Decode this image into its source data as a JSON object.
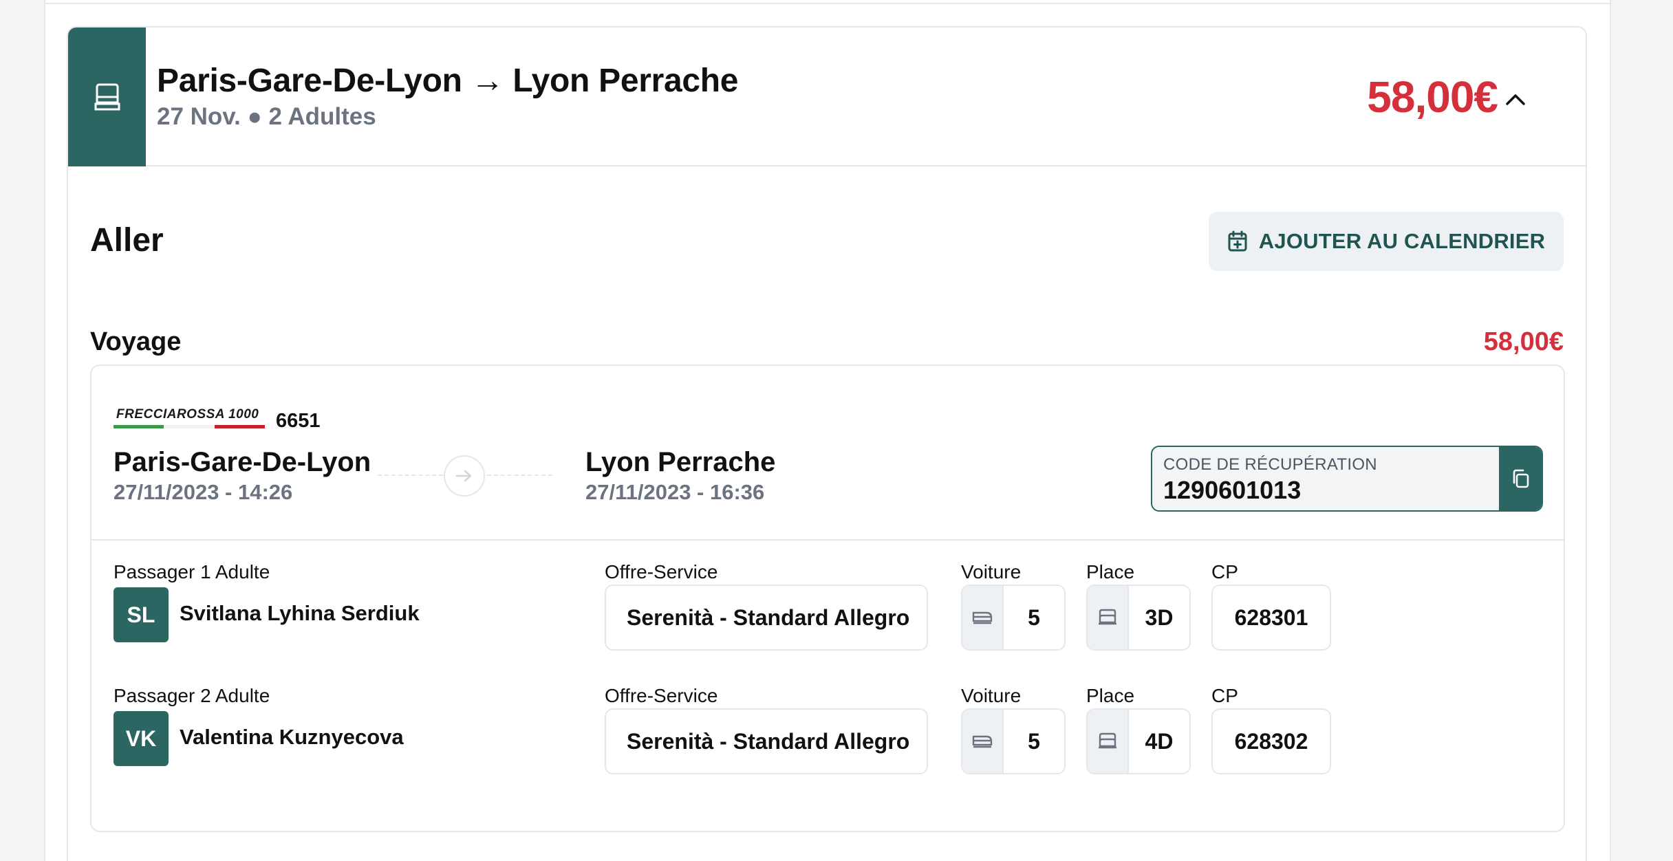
{
  "header": {
    "route_title": "Paris-Gare-De-Lyon → Lyon Perrache",
    "subtitle": "27 Nov. ● 2 Adultes",
    "price": "58,00€"
  },
  "outbound": {
    "section_title": "Aller",
    "calendar_button": "AJOUTER AU CALENDRIER",
    "voyage_label": "Voyage",
    "voyage_price": "58,00€"
  },
  "segment": {
    "carrier_logo_text": "FRECCIAROSSA 1000",
    "train_number": "6651",
    "departure": {
      "station": "Paris-Gare-De-Lyon",
      "datetime": "27/11/2023 - 14:26"
    },
    "arrival": {
      "station": "Lyon Perrache",
      "datetime": "27/11/2023 - 16:36"
    },
    "retrieval_code": {
      "label": "CODE DE RÉCUPÉRATION",
      "value": "1290601013"
    }
  },
  "labels": {
    "offer": "Offre-Service",
    "voiture": "Voiture",
    "place": "Place",
    "cp": "CP"
  },
  "passengers": [
    {
      "label": "Passager 1 Adulte",
      "initials": "SL",
      "name": "Svitlana Lyhina Serdiuk",
      "offer": "Serenità - Standard Allegro",
      "voiture": "5",
      "place": "3D",
      "cp": "628301"
    },
    {
      "label": "Passager 2 Adulte",
      "initials": "VK",
      "name": "Valentina Kuznyecova",
      "offer": "Serenità - Standard Allegro",
      "voiture": "5",
      "place": "4D",
      "cp": "628302"
    }
  ],
  "colors": {
    "brand_teal": "#2b6663",
    "price_red": "#d3303c",
    "muted_text": "#6b7280",
    "border": "#e5e7eb"
  },
  "icons": {
    "header": "seat-icon",
    "collapse": "chevron-up-icon",
    "calendar": "calendar-plus-icon",
    "route": "arrow-right-icon",
    "copy": "copy-icon",
    "voiture": "train-car-icon",
    "place": "seat-icon"
  }
}
